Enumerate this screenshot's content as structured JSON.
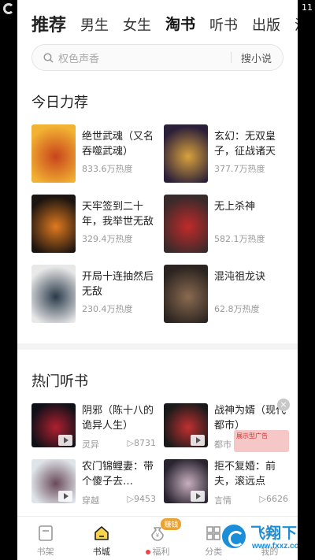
{
  "top_tabs": [
    "推荐",
    "男生",
    "女生",
    "淘书",
    "听书",
    "出版",
    "漫"
  ],
  "search": {
    "placeholder": "权色声香",
    "button": "搜小说"
  },
  "status": {
    "time": "11"
  },
  "today": {
    "title": "今日力荐",
    "books": [
      {
        "title": "绝世武魂（又名吞噬武魂）",
        "heat": "833.6万热度",
        "cover_colors": [
          "#f2b233",
          "#c8441b"
        ]
      },
      {
        "title": "玄幻：无双皇子，征战诸天",
        "heat": "377.7万热度",
        "cover_colors": [
          "#2b1f3a",
          "#d9a23c"
        ]
      },
      {
        "title": "天牢签到二十年，我举世无敌",
        "heat": "329.4万热度",
        "cover_colors": [
          "#1b1410",
          "#e07a1f"
        ]
      },
      {
        "title": "无上杀神",
        "heat": "582.1万热度",
        "cover_colors": [
          "#3a2a2a",
          "#c02a2a"
        ]
      },
      {
        "title": "开局十连抽然后无敌",
        "heat": "230.4万热度",
        "cover_colors": [
          "#e8e8e8",
          "#2a3a4a"
        ]
      },
      {
        "title": "混沌祖龙诀",
        "heat": "62.8万热度",
        "cover_colors": [
          "#2b2420",
          "#8a6a50"
        ]
      }
    ]
  },
  "audio": {
    "title": "热门听书",
    "books": [
      {
        "title": "阴邪（陈十八的诡异人生）",
        "genre": "灵异",
        "plays": "▷8731",
        "cover_colors": [
          "#101018",
          "#b02030"
        ]
      },
      {
        "title": "战神为婿（现代都市）",
        "genre": "都市",
        "plays": "",
        "cover_colors": [
          "#1a1a1a",
          "#c03030"
        ]
      },
      {
        "title": "农门锦鲤妻：带个傻子去…",
        "genre": "穿越",
        "plays": "▷9453",
        "cover_colors": [
          "#dfe4ea",
          "#6a4a5a"
        ]
      },
      {
        "title": "拒不复婚：前夫，滚远点",
        "genre": "言情",
        "plays": "▷6626",
        "cover_colors": [
          "#2a2430",
          "#c8b0c0"
        ]
      }
    ]
  },
  "ad": {
    "text": "展示型广告",
    "close": "×"
  },
  "bottom_nav": [
    {
      "label": "书架",
      "icon": "bookshelf-icon"
    },
    {
      "label": "书城",
      "icon": "bookstore-icon"
    },
    {
      "label": "福利",
      "icon": "gift-bag-icon",
      "badge": "赚钱"
    },
    {
      "label": "分类",
      "icon": "category-icon"
    },
    {
      "label": "我的",
      "icon": "profile-icon"
    }
  ],
  "watermark": {
    "text": "飞翔下载",
    "url": "www.fxxz.com"
  }
}
